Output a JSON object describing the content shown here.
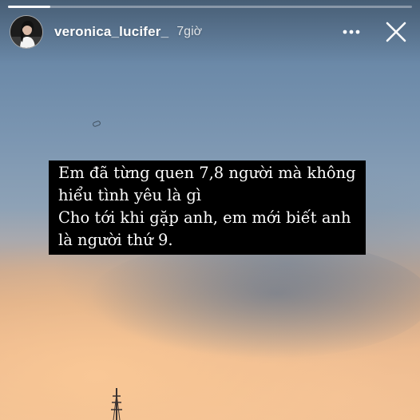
{
  "story": {
    "progress": 0.105,
    "user": {
      "username": "veronica_lucifer_",
      "time_posted": "7giờ",
      "avatar_icon": "profile-avatar"
    },
    "caption": {
      "lines": [
        "Em đã từng quen 7,8 người mà không",
        "hiểu tình yêu là gì",
        "Cho tới khi gặp anh, em mới biết anh",
        "là người thứ 9."
      ]
    },
    "icons": {
      "more": "more-horizontal-icon",
      "close": "close-icon"
    },
    "colors": {
      "caption_background": "#000000",
      "caption_text": "#ffffff",
      "sky_top": "#5f7d9c",
      "sunset": "#efbf93"
    }
  }
}
